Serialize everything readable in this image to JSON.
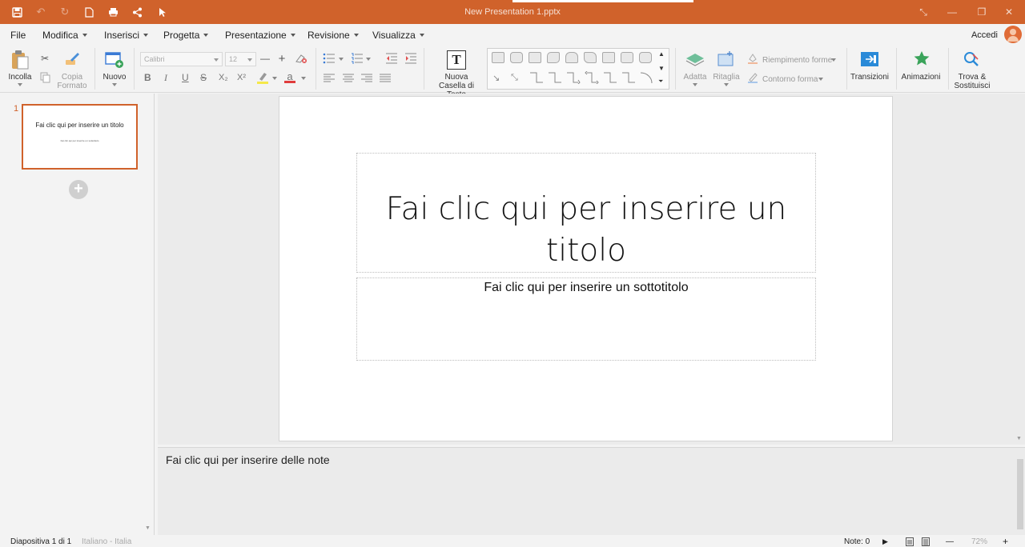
{
  "titlebar": {
    "document_title": "New Presentation 1.pptx",
    "quick_access": [
      "save-icon",
      "undo-icon",
      "redo-icon",
      "new-document-icon",
      "print-icon",
      "share-icon",
      "cursor-icon"
    ],
    "window_controls": [
      "fullscreen-icon",
      "minimize-icon",
      "restore-icon",
      "close-icon"
    ],
    "accent_color": "#d0622b"
  },
  "menubar": {
    "items": [
      "File",
      "Modifica",
      "Inserisci",
      "Progetta",
      "Presentazione",
      "Revisione",
      "Visualizza"
    ],
    "sign_in": "Accedi"
  },
  "ribbon": {
    "paste": "Incolla",
    "copy_format": [
      "Copia",
      "Formato"
    ],
    "new_slide": "Nuovo",
    "font_name": "Calibri",
    "font_size": "12",
    "bold": "B",
    "italic": "I",
    "underline": "U",
    "strike": "S",
    "subscript": "X₂",
    "superscript": "X²",
    "font_color_glyph": "a",
    "new_textbox": [
      "Nuova",
      "Casella di Testo"
    ],
    "textbox_glyph": "T",
    "fit": "Adatta",
    "crop": "Ritaglia",
    "shape_fill": "Riempimento forme",
    "shape_outline": "Contorno forma",
    "transitions": "Transizioni",
    "animations": "Animazioni",
    "find_replace": [
      "Trova &",
      "Sostituisci"
    ]
  },
  "slides_pane": {
    "slide_number": "1",
    "thumb_title": "Fai clic qui per inserire un titolo",
    "thumb_subtitle": "Fai clic qui per inserire un sottotitolo"
  },
  "slide": {
    "title_placeholder": "Fai clic qui per inserire un titolo",
    "subtitle_placeholder": "Fai clic qui per inserire un sottotitolo"
  },
  "notes": {
    "placeholder": "Fai clic qui per inserire delle note"
  },
  "statusbar": {
    "slide_position": "Diapositiva 1 di 1",
    "language": "Italiano - Italia",
    "notes_count": "Note: 0",
    "zoom": "72%"
  }
}
